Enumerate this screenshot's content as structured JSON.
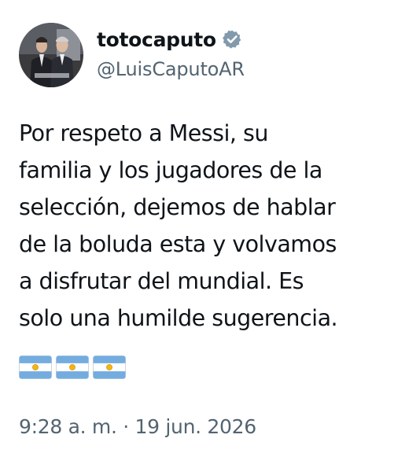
{
  "user": {
    "display_name": "totocaputo",
    "handle": "@LuisCaputoAR",
    "verified_icon": "verified-badge-icon",
    "avatar": "profile-photo-avatar"
  },
  "tweet": {
    "lines": [
      "Por respeto a Messi, su",
      "familia y los jugadores de la",
      "selección, dejemos de hablar",
      "de la boluda esta y volvamos",
      "a disfrutar del mundial. Es",
      "solo una humilde sugerencia."
    ],
    "emojis": [
      "argentina-flag-icon",
      "argentina-flag-icon",
      "argentina-flag-icon"
    ]
  },
  "meta": {
    "timestamp": "9:28 a. m. · 19 jun. 2026"
  },
  "colors": {
    "text": "#0f1419",
    "secondary": "#536471",
    "verified_badge": "#829aab",
    "flag_blue": "#74acdf",
    "flag_sun": "#f6b40e"
  }
}
